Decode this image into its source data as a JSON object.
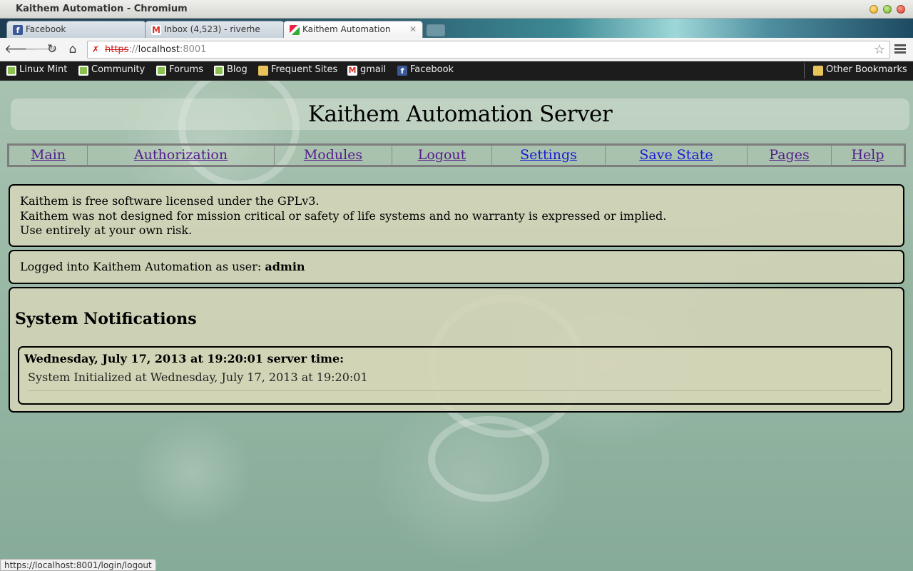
{
  "window": {
    "title": "Kaithem Automation - Chromium"
  },
  "tabs": [
    {
      "label": "Facebook",
      "icon": "facebook-icon"
    },
    {
      "label": "Inbox (4,523) - riverhe",
      "icon": "gmail-icon"
    },
    {
      "label": "Kaithem Automation",
      "icon": "kaithem-icon",
      "active": true
    }
  ],
  "toolbar": {
    "url_scheme": "https",
    "url_sep": "://",
    "url_host": "localhost",
    "url_port": ":8001"
  },
  "bookmarks": {
    "items": [
      {
        "label": "Linux Mint",
        "icon": "linux-mint-icon"
      },
      {
        "label": "Community",
        "icon": "linux-mint-icon"
      },
      {
        "label": "Forums",
        "icon": "linux-mint-icon"
      },
      {
        "label": "Blog",
        "icon": "linux-mint-icon"
      },
      {
        "label": "Frequent Sites",
        "icon": "folder-icon"
      },
      {
        "label": "gmail",
        "icon": "gmail-icon"
      },
      {
        "label": "Facebook",
        "icon": "facebook-icon"
      }
    ],
    "other": "Other Bookmarks"
  },
  "page": {
    "title": "Kaithem Automation Server",
    "nav": [
      {
        "label": "Main"
      },
      {
        "label": "Authorization"
      },
      {
        "label": "Modules"
      },
      {
        "label": "Logout"
      },
      {
        "label": "Settings"
      },
      {
        "label": "Save State"
      },
      {
        "label": "Pages"
      },
      {
        "label": "Help"
      }
    ],
    "license": {
      "line1": "Kaithem is free software licensed under the GPLv3.",
      "line2": "Kaithem was not designed for mission critical or safety of life systems and no warranty is expressed or implied.",
      "line3": "Use entirely at your own risk."
    },
    "login": {
      "prefix": "Logged into Kaithem Automation as user:",
      "user": "admin"
    },
    "notifications": {
      "heading": "System Notifications",
      "items": [
        {
          "time": "Wednesday, July 17, 2013 at 19:20:01 server time:",
          "message": "System Initialized at Wednesday, July 17, 2013 at 19:20:01"
        }
      ]
    }
  },
  "status_bar": "https://localhost:8001/login/logout"
}
